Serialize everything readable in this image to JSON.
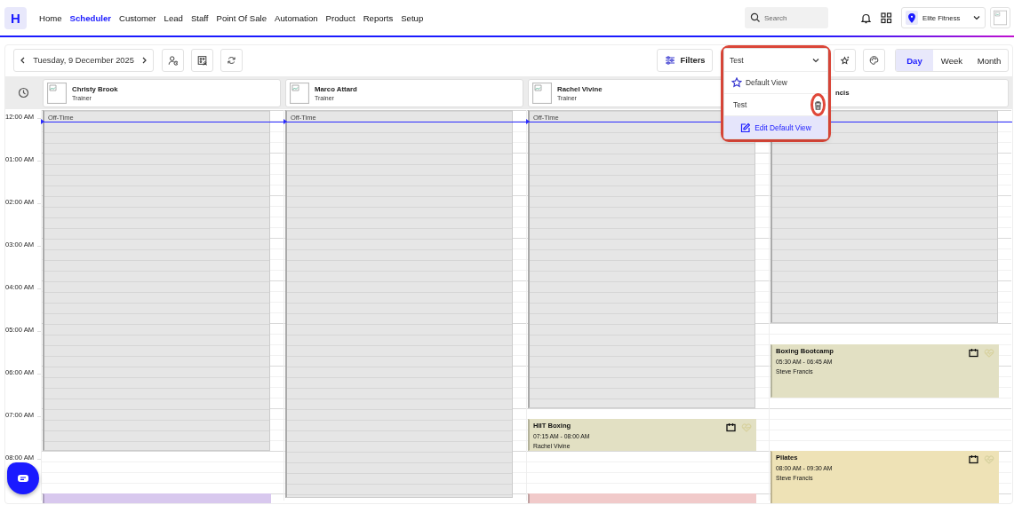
{
  "nav": {
    "logo": "H",
    "items": [
      {
        "label": "Home",
        "selected": false
      },
      {
        "label": "Scheduler",
        "selected": true
      },
      {
        "label": "Customer",
        "selected": false
      },
      {
        "label": "Lead",
        "selected": false
      },
      {
        "label": "Staff",
        "selected": false
      },
      {
        "label": "Point Of Sale",
        "selected": false
      },
      {
        "label": "Automation",
        "selected": false
      },
      {
        "label": "Product",
        "selected": false
      },
      {
        "label": "Reports",
        "selected": false
      },
      {
        "label": "Setup",
        "selected": false
      }
    ]
  },
  "search": {
    "placeholder": "Search"
  },
  "location": "Elite Fitness",
  "toolbar": {
    "date": "Tuesday, 9 December 2025",
    "filters": "Filters",
    "view_select": "Test",
    "views": [
      {
        "label": "Day",
        "selected": true
      },
      {
        "label": "Week",
        "selected": false
      },
      {
        "label": "Month",
        "selected": false
      }
    ]
  },
  "view_menu": {
    "items": [
      {
        "label": "Default View",
        "kind": "default"
      },
      {
        "label": "Test",
        "kind": "saved"
      }
    ],
    "footer": "Edit Default View"
  },
  "time_labels": [
    "12:00 AM",
    "01:00 AM",
    "02:00 AM",
    "03:00 AM",
    "04:00 AM",
    "05:00 AM",
    "06:00 AM",
    "07:00 AM",
    "08:00 AM"
  ],
  "staff": [
    {
      "name": "Christy Brook",
      "role": "Trainer",
      "covered": false,
      "off_time": "Off-Time",
      "events": [
        {
          "color": "#d8c8ee"
        }
      ]
    },
    {
      "name": "Marco Attard",
      "role": "Trainer",
      "covered": false,
      "off_time": "Off-Time"
    },
    {
      "name": "Rachel Vivine",
      "role": "Trainer",
      "covered": false,
      "off_time": "Off-Time",
      "events": [
        {
          "title": "HIIT Boxing",
          "time": "07:15 AM - 08:00 AM",
          "person": "Rachel Vivine",
          "color": "#e2e0c3"
        },
        {
          "color": "#f1caca"
        }
      ]
    },
    {
      "name": "ncis",
      "covered": true,
      "events": [
        {
          "title": "Boxing Bootcamp",
          "time": "05:30 AM - 06:45 AM",
          "person": "Steve Francis",
          "color": "#e2e0c3"
        },
        {
          "title": "Pilates",
          "time": "08:00 AM - 09:30 AM",
          "person": "Steve Francis",
          "color": "#eee2b6"
        }
      ]
    }
  ]
}
